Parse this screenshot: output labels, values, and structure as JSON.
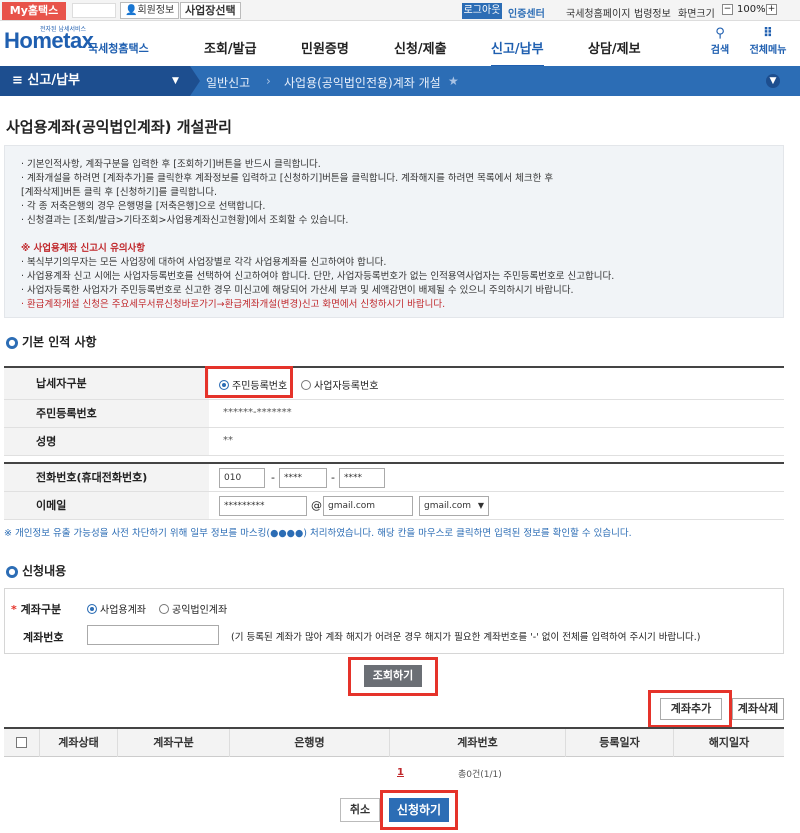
{
  "topbar": {
    "my_tab": "My홈택스",
    "member_info": "회원정보",
    "business_select": "사업장선택",
    "logout": "로그아웃",
    "cert_center": "인증센터",
    "links": [
      "국세청홈페이지",
      "법령정보",
      "화면크기"
    ],
    "zoom": "100%"
  },
  "header": {
    "logo_main": "Hometax",
    "logo_sub": "국세청홈택스",
    "logo_tiny": "전자된 납세서비스",
    "menu": [
      "조회/발급",
      "민원증명",
      "신청/제출",
      "신고/납부",
      "상담/제보"
    ],
    "active_menu": "신고/납부",
    "search": "검색",
    "all_menu": "전체메뉴"
  },
  "nav": {
    "current": "신고/납부",
    "crumbs": [
      "일반신고",
      "사업용(공익법인전용)계좌 개설"
    ]
  },
  "page": {
    "title": "사업용계좌(공익법인계좌) 개설관리"
  },
  "notice": {
    "lines": [
      "· 기본인적사항, 계좌구분을 입력한 후 [조회하기]버튼을 반드시 클릭합니다.",
      "· 계좌개설을 하려면 [계좌추가]를 클릭한후 계좌정보를 입력하고 [신청하기]버튼을 클릭합니다. 계좌해지를 하려면 목록에서 체크한 후",
      "  [계좌삭제]버튼 클릭 후 [신청하기]를 클릭합니다.",
      "· 각 종 저축은행의 경우 은행명을 [저축은행]으로 선택합니다.",
      "· 신청결과는 [조회/발급>기타조회>사업용계좌신고현황]에서 조회할 수 있습니다."
    ],
    "warn_title": "※ 사업용계좌 신고시 유의사항",
    "warn_lines": [
      "· 복식부기의무자는 모든 사업장에 대하여 사업장별로 각각 사업용계좌를 신고하여야 합니다.",
      "· 사업용계좌 신고 시에는 사업자등록번호를 선택하여 신고하여야 합니다. 단만, 사업자등록번호가 없는 인적용역사업자는 주민등록번호로 신고합니다.",
      "· 사업자등록한 사업자가 주민등록번호로 신고한 경우 미신고에 해당되어 가산세 부과 및 세액감면이 배제될 수 있으니 주의하시기 바랍니다.",
      "· 환급계좌개설 신청은 주요세무서류신청바로가기→환급계좌개설(변경)신고 화면에서 신청하시기 바랍니다."
    ]
  },
  "basic": {
    "heading": "기본 인적 사항",
    "taxpayer_type_label": "납세자구분",
    "type_options": [
      "주민등록번호",
      "사업자등록번호"
    ],
    "rrn_label": "주민등록번호",
    "rrn_value": "******-*******",
    "name_label": "성명",
    "name_value": "**",
    "phone_label": "전화번호(휴대전화번호)",
    "phone": [
      "010",
      "****",
      "****"
    ],
    "email_label": "이메일",
    "email_id": "*********",
    "email_at": "@",
    "email_domain": "gmail.com",
    "email_select": "gmail.com"
  },
  "privacy_note": "※ 개인정보 유출 가능성을 사전 차단하기 위해 일부 정보를 마스킹(●●●●) 처리하였습니다. 해당 칸을 마우스로 클릭하면 입력된 정보를 확인할 수 있습니다.",
  "apply": {
    "heading": "신청내용",
    "account_type_label": "계좌구분",
    "account_type_options": [
      "사업용계좌",
      "공익법인계좌"
    ],
    "account_no_label": "계좌번호",
    "account_no_hint": "(기 등록된 계좌가 많아 계좌 해지가 어려운 경우 해지가 필요한 계좌번호를 '-' 없이 전체를 입력하여 주시기 바랍니다.)"
  },
  "buttons": {
    "search": "조회하기",
    "add_account": "계좌추가",
    "delete_account": "계좌삭제",
    "cancel": "취소",
    "submit": "신청하기"
  },
  "table": {
    "headers": [
      "계좌상태",
      "계좌구분",
      "은행명",
      "계좌번호",
      "등록일자",
      "해지일자"
    ]
  },
  "pager": {
    "page": "1",
    "total": "총0건(1/1)"
  },
  "colors": {
    "primary": "#2c6db5",
    "highlight": "#e5332a",
    "notice_red": "#c0282c"
  }
}
